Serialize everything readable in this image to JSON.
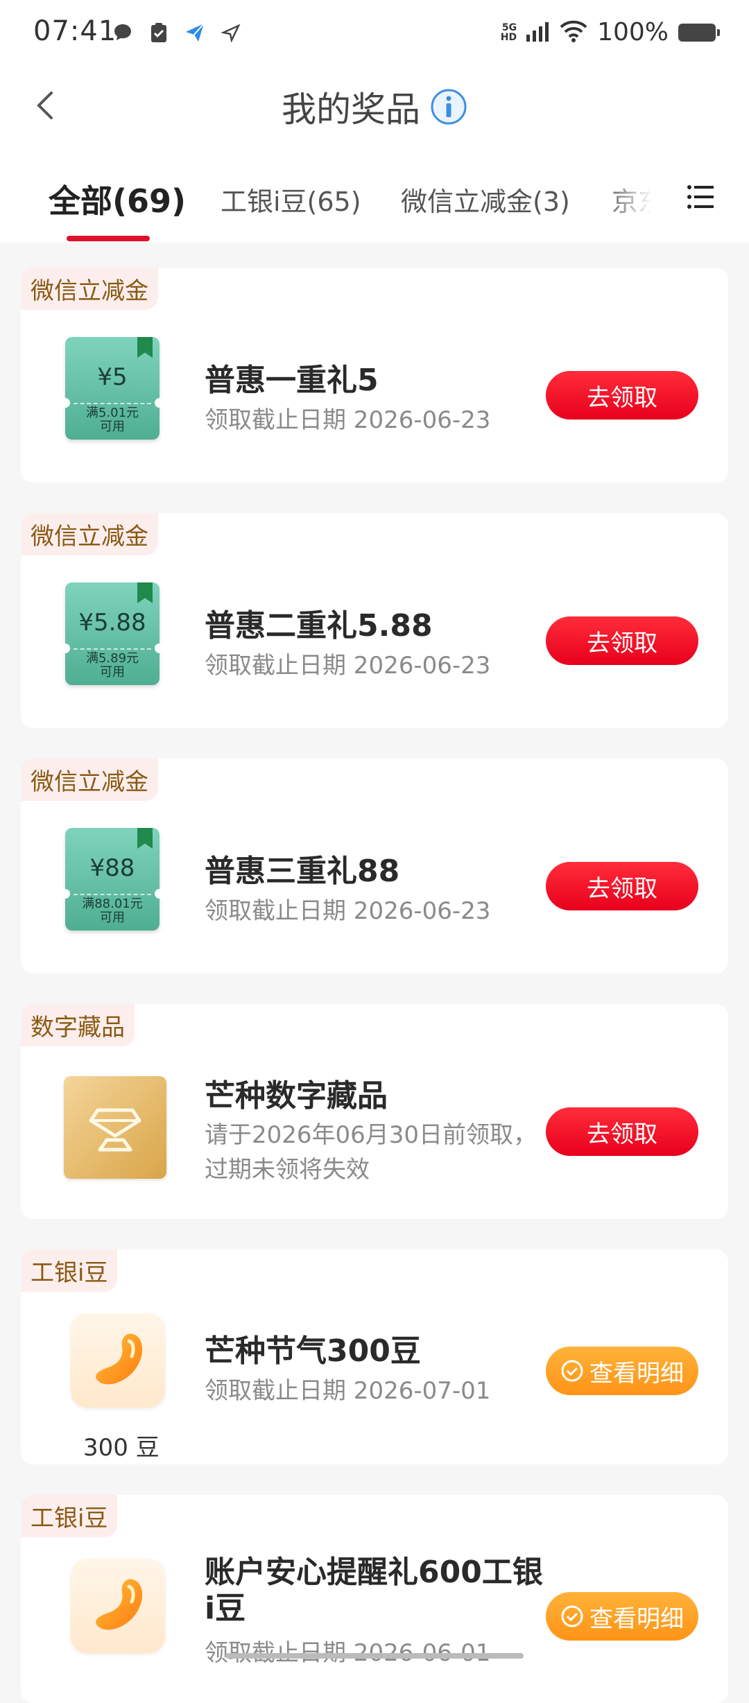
{
  "status": {
    "time": "07:41",
    "network": "5G HD",
    "battery": "100%"
  },
  "header": {
    "title": "我的奖品"
  },
  "tabs": [
    "全部(69)",
    "工银i豆(65)",
    "微信立减金(3)",
    "京东"
  ],
  "cards": [
    {
      "category": "微信立减金",
      "thumb": {
        "amount": "¥5",
        "cond1": "满5.01元",
        "cond2": "可用"
      },
      "title": "普惠一重礼5",
      "sub": "领取截止日期 2026-06-23",
      "button": "去领取"
    },
    {
      "category": "微信立减金",
      "thumb": {
        "amount": "¥5.88",
        "cond1": "满5.89元",
        "cond2": "可用"
      },
      "title": "普惠二重礼5.88",
      "sub": "领取截止日期 2026-06-23",
      "button": "去领取"
    },
    {
      "category": "微信立减金",
      "thumb": {
        "amount": "¥88",
        "cond1": "满88.01元",
        "cond2": "可用"
      },
      "title": "普惠三重礼88",
      "sub": "领取截止日期 2026-06-23",
      "button": "去领取"
    },
    {
      "category": "数字藏品",
      "title": "芒种数字藏品",
      "sub": "请于2026年06月30日前领取，过期未领将失效",
      "button": "去领取"
    },
    {
      "category": "工银i豆",
      "caption": "300 豆",
      "title": "芒种节气300豆",
      "sub": "领取截止日期 2026-07-01",
      "button": "查看明细"
    },
    {
      "category": "工银i豆",
      "title": "账户安心提醒礼600工银i豆",
      "sub": "领取截止日期 2026-06-01",
      "button": "查看明细"
    }
  ]
}
